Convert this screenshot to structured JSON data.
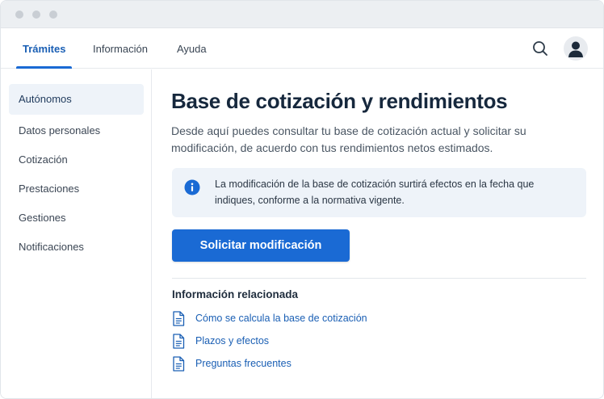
{
  "colors": {
    "accent": "#1a6ad4",
    "link": "#1a5fb4",
    "info_bg": "#eef3f9",
    "sidebar_active_bg": "#eef3f9",
    "title": "#16283d"
  },
  "header": {
    "tabs": [
      {
        "label": "Trámites",
        "active": true
      },
      {
        "label": "Información",
        "active": false
      },
      {
        "label": "Ayuda",
        "active": false
      }
    ],
    "icons": [
      "search-icon",
      "user-avatar-icon"
    ]
  },
  "sidebar": {
    "items": [
      {
        "label": "Autónomos",
        "active": true
      },
      {
        "label": "Datos personales",
        "active": false
      },
      {
        "label": "Cotización",
        "active": false
      },
      {
        "label": "Prestaciones",
        "active": false
      },
      {
        "label": "Gestiones",
        "active": false
      },
      {
        "label": "Notificaciones",
        "active": false
      }
    ]
  },
  "main": {
    "title": "Base de cotización y rendimientos",
    "description": "Desde aquí puedes consultar tu base de cotización actual y solicitar su modificación, de acuerdo con tus rendimientos netos estimados.",
    "info_box": {
      "icon": "info-icon",
      "text": "La modificación de la base de cotización surtirá efectos en la fecha que indiques, conforme a la normativa vigente."
    },
    "primary_button": "Solicitar modificación",
    "related": {
      "heading": "Información relacionada",
      "links": [
        {
          "label": "Cómo se calcula la base de cotización",
          "icon": "document-icon"
        },
        {
          "label": "Plazos y efectos",
          "icon": "document-icon"
        },
        {
          "label": "Preguntas frecuentes",
          "icon": "document-icon"
        }
      ]
    }
  }
}
